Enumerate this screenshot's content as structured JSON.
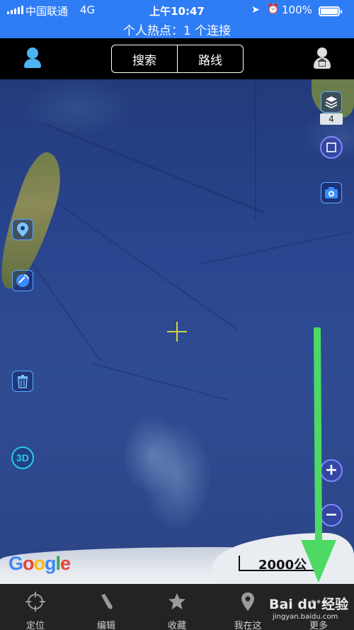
{
  "status_bar": {
    "carrier": "中国联通",
    "network": "4G",
    "time": "上午10:47",
    "battery_pct": "100%",
    "battery_level": 1.0
  },
  "hotspot_banner": "个人热点：1 个连接",
  "topnav": {
    "search_label": "搜索",
    "route_label": "路线"
  },
  "map": {
    "layers_count": "4",
    "btn_3d": "3D",
    "zoom_in": "+",
    "zoom_out": "−",
    "google_logo": [
      "G",
      "o",
      "o",
      "g",
      "l",
      "e"
    ],
    "scale_text": "2000公",
    "crosshair_color": "#d6d243"
  },
  "tabs": [
    {
      "label": "定位",
      "icon": "crosshair-icon"
    },
    {
      "label": "编辑",
      "icon": "pencil-icon"
    },
    {
      "label": "收藏",
      "icon": "star-icon"
    },
    {
      "label": "我在这",
      "icon": "location-pin-icon"
    },
    {
      "label": "更多",
      "icon": "more-icon"
    }
  ],
  "watermark": {
    "brand": "Bai du 经验",
    "url": "jingyan.baidu.com"
  },
  "colors": {
    "status_blue": "#2f7df5",
    "accent_blue": "#5aa9ff",
    "annotation_green": "#4cd964"
  }
}
